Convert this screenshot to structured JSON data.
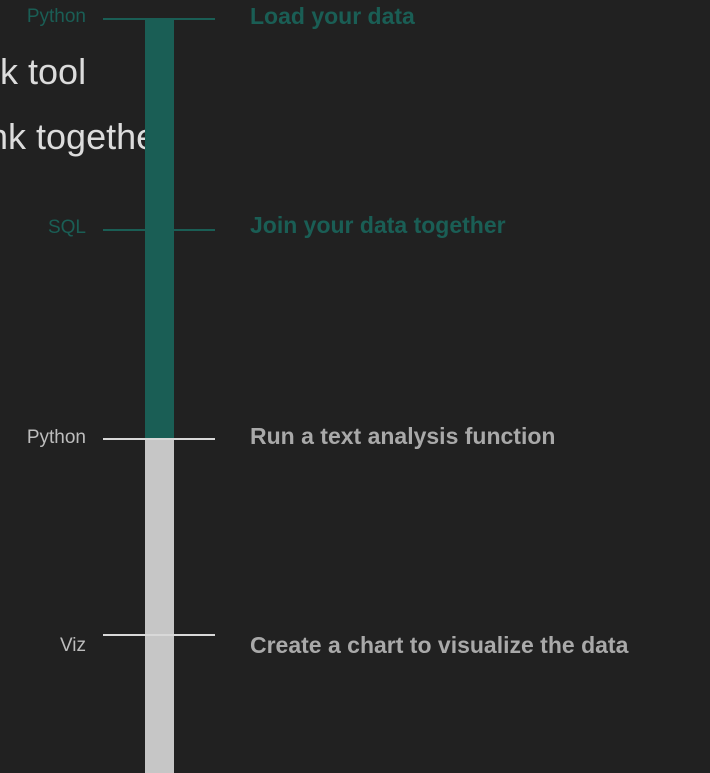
{
  "background_text": [
    "ok tool",
    "ink together"
  ],
  "progress": {
    "completed_steps": 3,
    "total_steps": 4
  },
  "steps": [
    {
      "language": "Python",
      "label": "Load your data",
      "status": "done"
    },
    {
      "language": "SQL",
      "label": "Join your data together",
      "status": "done"
    },
    {
      "language": "Python",
      "label": "Run a text analysis function",
      "status": "todo"
    },
    {
      "language": "Viz",
      "label": "Create a chart to visualize the data",
      "status": "todo"
    }
  ],
  "colors": {
    "background": "#212121",
    "complete": "#1a5e55",
    "incomplete_bar": "#c6c6c6",
    "incomplete_text": "#a9a9a9"
  }
}
